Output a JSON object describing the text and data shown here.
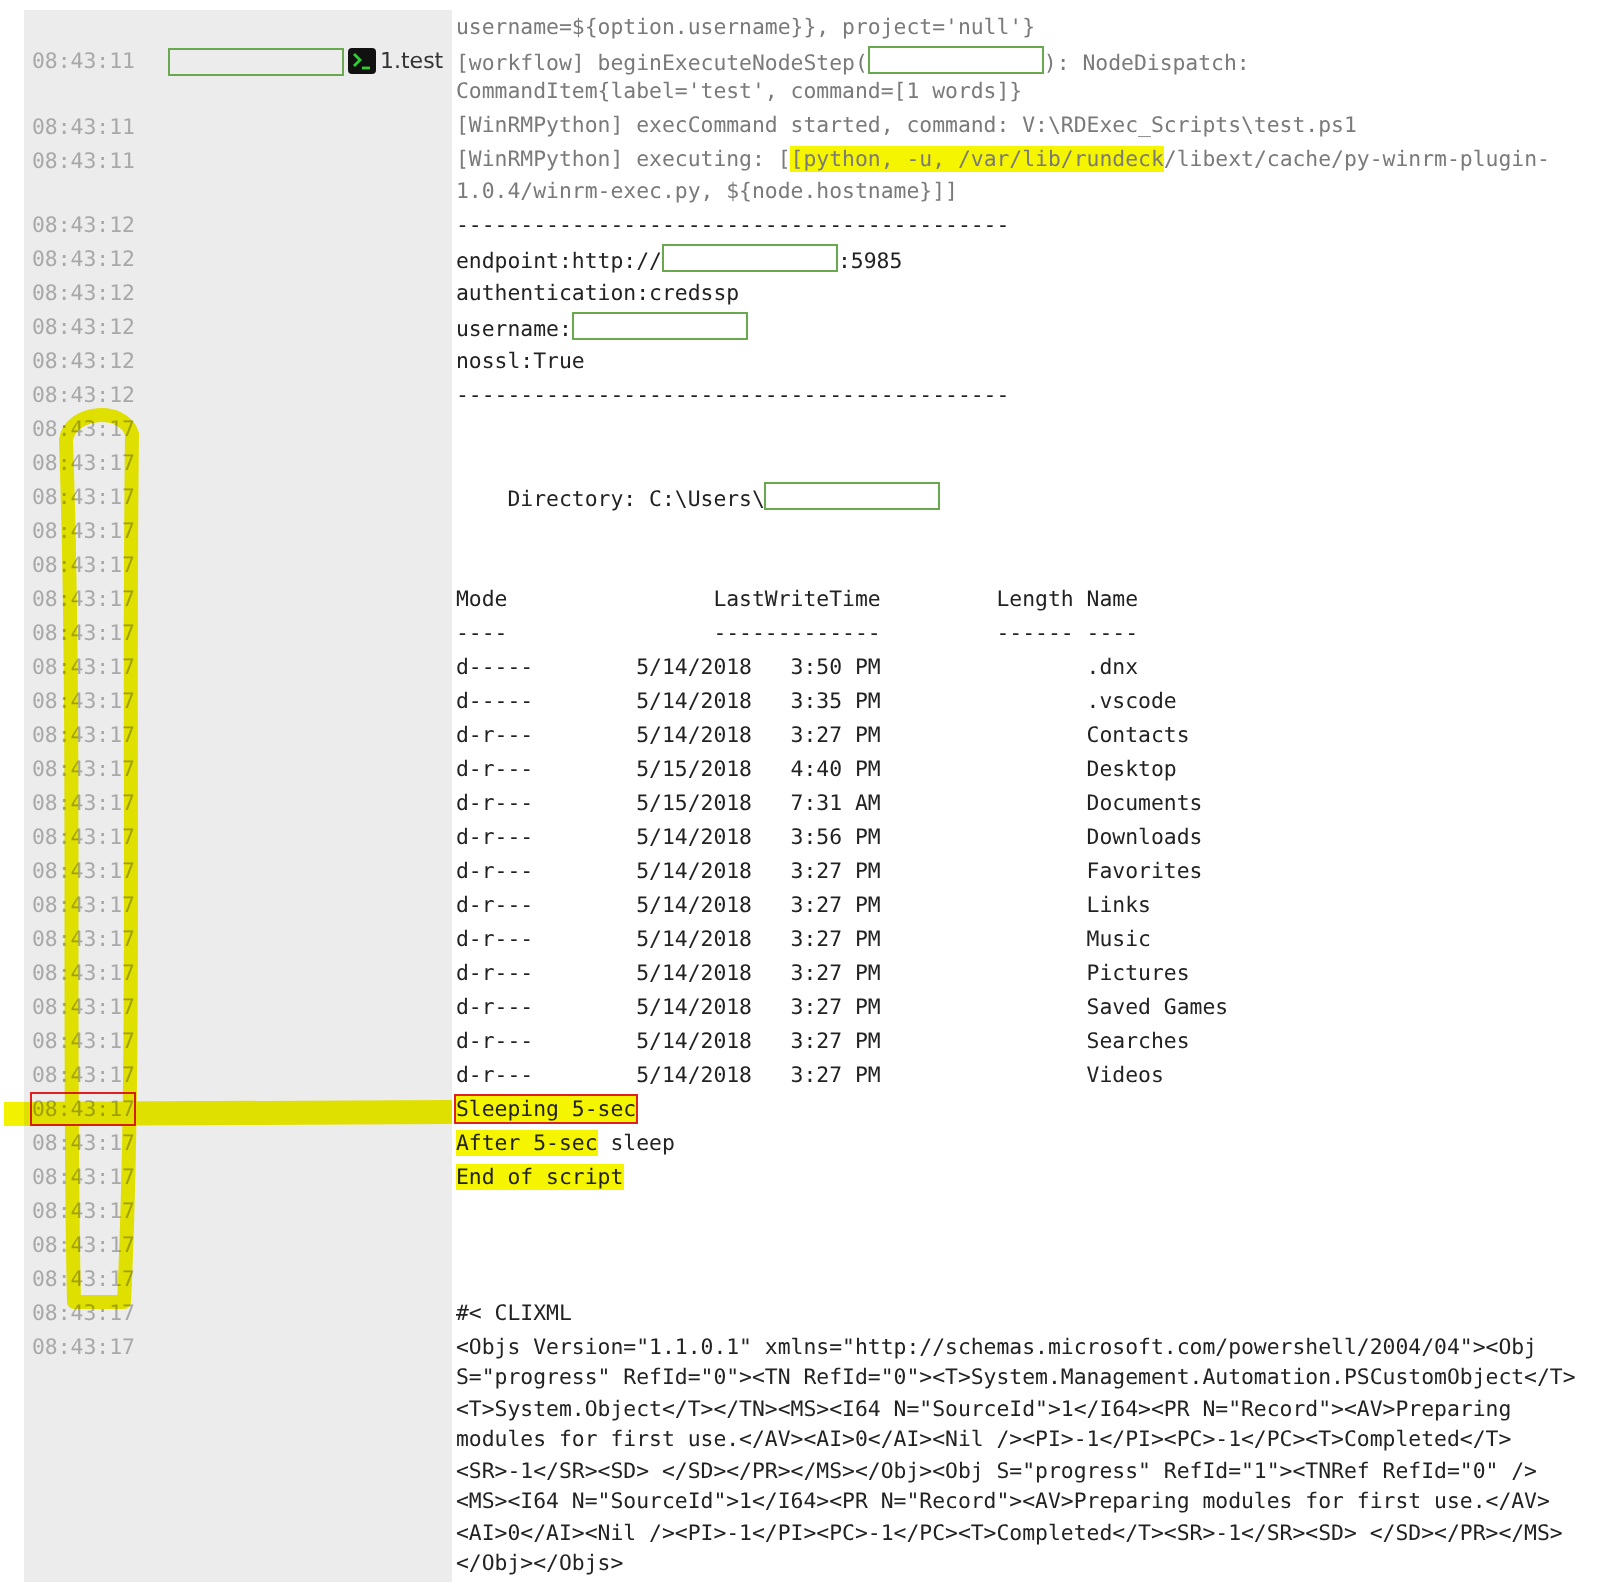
{
  "annotations": {
    "highlighter_loop": true
  },
  "log": {
    "header_line": "username=${option.username}}, project='null'}",
    "entries": [
      {
        "time": "08:43:11",
        "time_boxed": false,
        "node": {
          "label": "1.test"
        },
        "kind": "log",
        "lines": [
          [
            {
              "kind": "text",
              "text": "[workflow] beginExecuteNodeStep("
            },
            {
              "kind": "redacted"
            },
            {
              "kind": "text",
              "text": "): NodeDispatch:"
            }
          ],
          "CommandItem{label='test', command=[1 words]}"
        ]
      },
      {
        "time": "08:43:11",
        "time_boxed": false,
        "kind": "log",
        "lines": [
          "[WinRMPython] execCommand started, command: V:\\RDExec_Scripts\\test.ps1"
        ]
      },
      {
        "time": "08:43:11",
        "time_boxed": false,
        "kind": "log",
        "lines": [
          [
            {
              "kind": "text",
              "text": "[WinRMPython] executing: ["
            },
            {
              "kind": "highlight",
              "text": "[python, -u, /var/lib/rundeck"
            },
            {
              "kind": "text",
              "text": "/libext/cache/py-winrm-plugin-"
            }
          ],
          "1.0.4/winrm-exec.py, ${node.hostname}]]"
        ]
      },
      {
        "time": "08:43:12",
        "time_boxed": false,
        "kind": "output",
        "lines": [
          "-------------------------------------------"
        ]
      },
      {
        "time": "08:43:12",
        "time_boxed": false,
        "kind": "output",
        "lines": [
          [
            {
              "kind": "text",
              "text": "endpoint:http://"
            },
            {
              "kind": "redacted"
            },
            {
              "kind": "text",
              "text": ":5985"
            }
          ]
        ]
      },
      {
        "time": "08:43:12",
        "time_boxed": false,
        "kind": "output",
        "lines": [
          "authentication:credssp"
        ]
      },
      {
        "time": "08:43:12",
        "time_boxed": false,
        "kind": "output",
        "lines": [
          [
            {
              "kind": "text",
              "text": "username:"
            },
            {
              "kind": "redacted"
            }
          ]
        ]
      },
      {
        "time": "08:43:12",
        "time_boxed": false,
        "kind": "output",
        "lines": [
          "nossl:True"
        ]
      },
      {
        "time": "08:43:12",
        "time_boxed": false,
        "kind": "output",
        "lines": [
          "-------------------------------------------"
        ]
      },
      {
        "time": "08:43:17",
        "time_boxed": false,
        "kind": "output"
      },
      {
        "time": "08:43:17",
        "time_boxed": false,
        "kind": "output"
      },
      {
        "time": "08:43:17",
        "time_boxed": false,
        "kind": "output",
        "lines": [
          [
            {
              "kind": "text",
              "text": "    Directory: C:\\Users\\"
            },
            {
              "kind": "redacted"
            }
          ]
        ]
      },
      {
        "time": "08:43:17",
        "time_boxed": false,
        "kind": "output"
      },
      {
        "time": "08:43:17",
        "time_boxed": false,
        "kind": "output"
      },
      {
        "time": "08:43:17",
        "time_boxed": false,
        "kind": "output",
        "lines": [
          "Mode                LastWriteTime         Length Name"
        ]
      },
      {
        "time": "08:43:17",
        "time_boxed": false,
        "kind": "output",
        "lines": [
          "----                -------------         ------ ----"
        ]
      },
      {
        "time": "08:43:17",
        "time_boxed": false,
        "kind": "output",
        "lines": [
          "d-----        5/14/2018   3:50 PM                .dnx"
        ]
      },
      {
        "time": "08:43:17",
        "time_boxed": false,
        "kind": "output",
        "lines": [
          "d-----        5/14/2018   3:35 PM                .vscode"
        ]
      },
      {
        "time": "08:43:17",
        "time_boxed": false,
        "kind": "output",
        "lines": [
          "d-r---        5/14/2018   3:27 PM                Contacts"
        ]
      },
      {
        "time": "08:43:17",
        "time_boxed": false,
        "kind": "output",
        "lines": [
          "d-r---        5/15/2018   4:40 PM                Desktop"
        ]
      },
      {
        "time": "08:43:17",
        "time_boxed": false,
        "kind": "output",
        "lines": [
          "d-r---        5/15/2018   7:31 AM                Documents"
        ]
      },
      {
        "time": "08:43:17",
        "time_boxed": false,
        "kind": "output",
        "lines": [
          "d-r---        5/14/2018   3:56 PM                Downloads"
        ]
      },
      {
        "time": "08:43:17",
        "time_boxed": false,
        "kind": "output",
        "lines": [
          "d-r---        5/14/2018   3:27 PM                Favorites"
        ]
      },
      {
        "time": "08:43:17",
        "time_boxed": false,
        "kind": "output",
        "lines": [
          "d-r---        5/14/2018   3:27 PM                Links"
        ]
      },
      {
        "time": "08:43:17",
        "time_boxed": false,
        "kind": "output",
        "lines": [
          "d-r---        5/14/2018   3:27 PM                Music"
        ]
      },
      {
        "time": "08:43:17",
        "time_boxed": false,
        "kind": "output",
        "lines": [
          "d-r---        5/14/2018   3:27 PM                Pictures"
        ]
      },
      {
        "time": "08:43:17",
        "time_boxed": false,
        "kind": "output",
        "lines": [
          "d-r---        5/14/2018   3:27 PM                Saved Games"
        ]
      },
      {
        "time": "08:43:17",
        "time_boxed": false,
        "kind": "output",
        "lines": [
          "d-r---        5/14/2018   3:27 PM                Searches"
        ]
      },
      {
        "time": "08:43:17",
        "time_boxed": false,
        "kind": "output",
        "lines": [
          "d-r---        5/14/2018   3:27 PM                Videos"
        ]
      },
      {
        "time": "08:43:17",
        "time_boxed": true,
        "kind": "output",
        "lines": [
          [
            {
              "kind": "highlight_boxed",
              "text": "Sleeping 5-sec"
            }
          ]
        ]
      },
      {
        "time": "08:43:17",
        "time_boxed": false,
        "kind": "output",
        "lines": [
          [
            {
              "kind": "highlight",
              "text": "After 5-sec"
            },
            {
              "kind": "text",
              "text": " sleep"
            }
          ]
        ]
      },
      {
        "time": "08:43:17",
        "time_boxed": false,
        "kind": "output",
        "lines": [
          [
            {
              "kind": "highlight",
              "text": "End of script"
            }
          ]
        ]
      },
      {
        "time": "08:43:17",
        "time_boxed": false,
        "kind": "output"
      },
      {
        "time": "08:43:17",
        "time_boxed": false,
        "kind": "output"
      },
      {
        "time": "08:43:17",
        "time_boxed": false,
        "kind": "output"
      },
      {
        "time": "08:43:17",
        "time_boxed": false,
        "kind": "output",
        "lines": [
          "#< CLIXML"
        ]
      },
      {
        "time": "08:43:17",
        "time_boxed": false,
        "kind": "output",
        "lines": [
          "<Objs Version=\"1.1.0.1\" xmlns=\"http://schemas.microsoft.com/powershell/2004/04\"><Obj",
          "S=\"progress\" RefId=\"0\"><TN RefId=\"0\"><T>System.Management.Automation.PSCustomObject</T>",
          "<T>System.Object</T></TN><MS><I64 N=\"SourceId\">1</I64><PR N=\"Record\"><AV>Preparing",
          "modules for first use.</AV><AI>0</AI><Nil /><PI>-1</PI><PC>-1</PC><T>Completed</T>",
          "<SR>-1</SR><SD> </SD></PR></MS></Obj><Obj S=\"progress\" RefId=\"1\"><TNRef RefId=\"0\" />",
          "<MS><I64 N=\"SourceId\">1</I64><PR N=\"Record\"><AV>Preparing modules for first use.</AV>",
          "<AI>0</AI><Nil /><PI>-1</PI><PC>-1</PC><T>Completed</T><SR>-1</SR><SD> </SD></PR></MS>",
          "</Obj></Objs>"
        ]
      }
    ]
  }
}
